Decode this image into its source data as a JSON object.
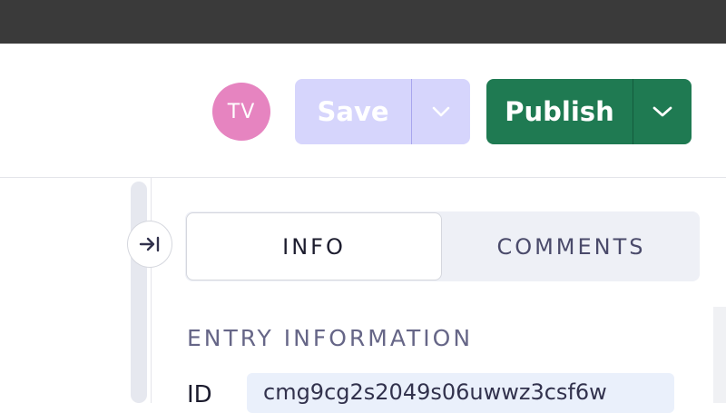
{
  "header": {
    "avatar_initials": "TV",
    "save_label": "Save",
    "publish_label": "Publish"
  },
  "panel": {
    "tabs": [
      {
        "label": "INFO",
        "selected": true
      },
      {
        "label": "COMMENTS",
        "selected": false
      }
    ],
    "section_title": "ENTRY INFORMATION",
    "fields": [
      {
        "label": "ID",
        "value": "cmg9cg2s2049s06uwwz3csf6w"
      }
    ]
  },
  "colors": {
    "publish_bg": "#1f7a52",
    "save_bg_disabled": "#d6d5fc",
    "avatar_bg": "#e684c0"
  },
  "icons": [
    "chevron-down-icon",
    "collapse-right-icon"
  ]
}
